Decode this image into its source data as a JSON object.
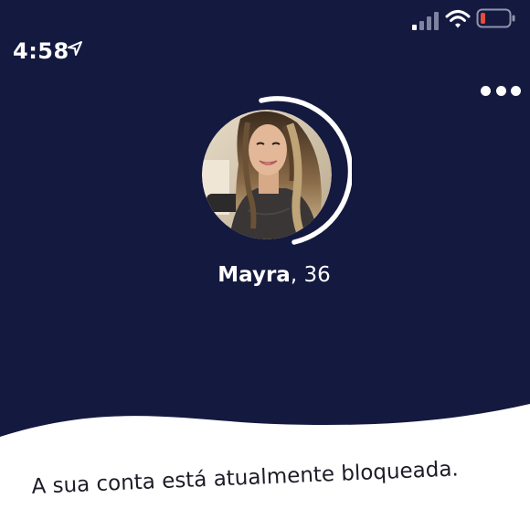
{
  "status_bar": {
    "time": "4:58",
    "icons": [
      "location-arrow-icon",
      "signal-icon",
      "wifi-icon",
      "battery-icon"
    ],
    "battery_color": "#e74c3c"
  },
  "header": {
    "more_icon": "more-dots-icon"
  },
  "profile": {
    "name": "Mayra",
    "separator": ", ",
    "age": "36",
    "ring_color": "#ffffff"
  },
  "account": {
    "status_message": "A sua conta está atualmente bloqueada."
  },
  "colors": {
    "background": "#14193f",
    "card": "#ffffff",
    "text_dark": "#1d1d28"
  }
}
